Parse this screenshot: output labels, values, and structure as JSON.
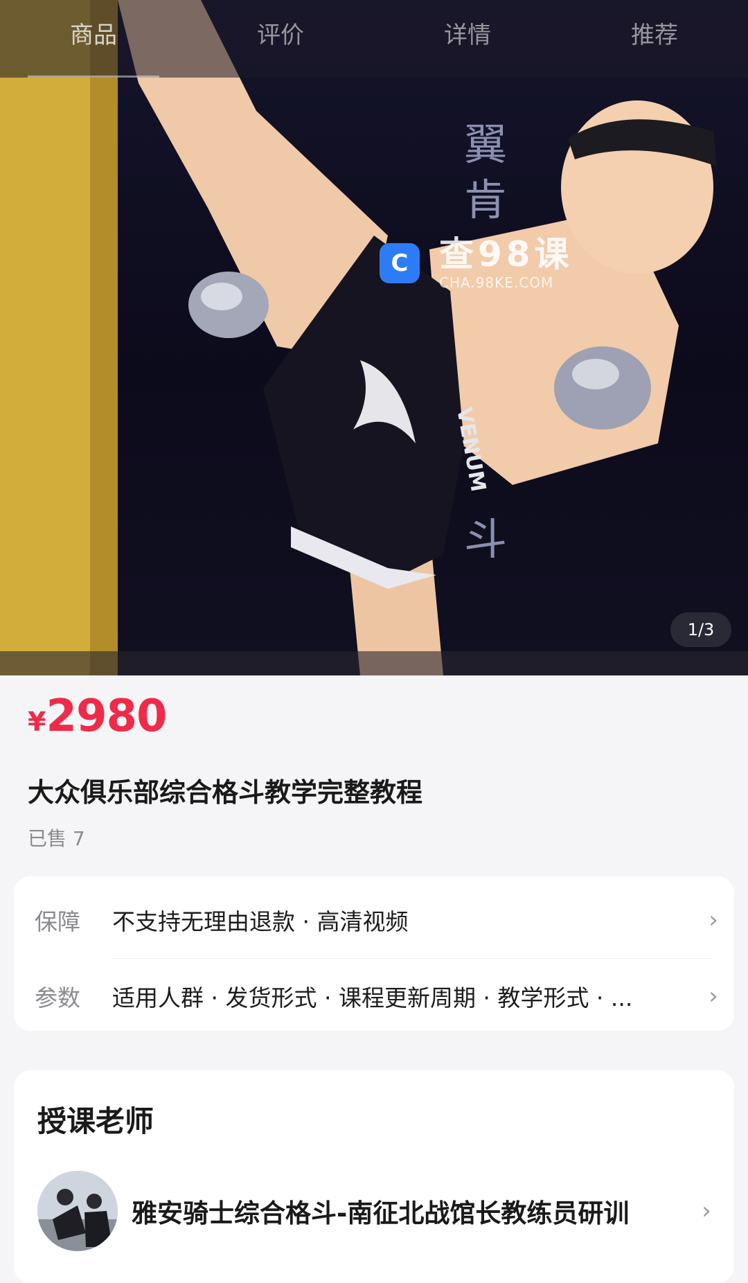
{
  "tabs": [
    {
      "label": "商品",
      "active": true
    },
    {
      "label": "评价",
      "active": false
    },
    {
      "label": "详情",
      "active": false
    },
    {
      "label": "推荐",
      "active": false
    }
  ],
  "gallery": {
    "page_indicator": "1/3",
    "watermark_main": "查98课",
    "watermark_sub": "CHA.98KE.COM",
    "shorts_brand": "VENUM"
  },
  "product": {
    "currency": "¥",
    "price": "2980",
    "title": "大众俱乐部综合格斗教学完整教程",
    "sold": "已售 7"
  },
  "specs": [
    {
      "label": "保障",
      "value": "不支持无理由退款 · 高清视频"
    },
    {
      "label": "参数",
      "value": "适用人群 · 发货形式 · 课程更新周期 · 教学形式 · ..."
    }
  ],
  "teacher": {
    "heading": "授课老师",
    "name": "雅安骑士综合格斗-南征北战馆长教练员研训"
  },
  "colors": {
    "price": "#f02b4a",
    "background": "#f5f5f7",
    "card": "#ffffff"
  }
}
